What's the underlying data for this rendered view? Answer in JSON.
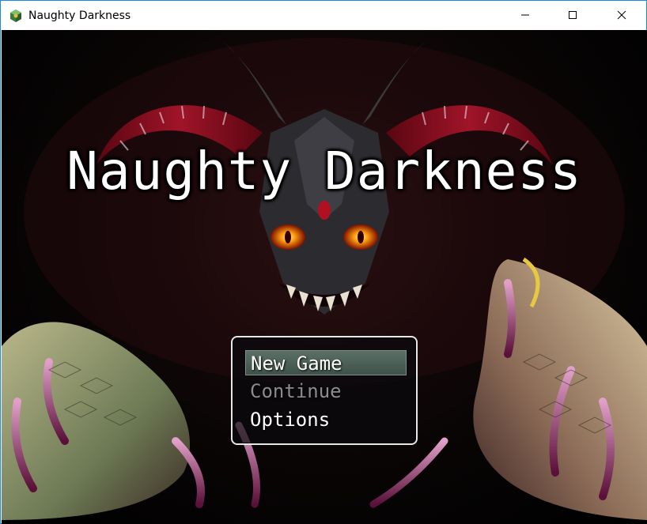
{
  "window": {
    "title": "Naughty Darkness",
    "app_icon": "game-app-icon",
    "controls": {
      "minimize": "minimize-icon",
      "maximize": "maximize-icon",
      "close": "close-icon"
    },
    "accent_color": "#1c8ad6"
  },
  "game": {
    "title": "Naughty Darkness",
    "background": "demon-artwork",
    "menu": {
      "items": [
        {
          "label": "New Game",
          "state": "selected"
        },
        {
          "label": "Continue",
          "state": "disabled"
        },
        {
          "label": "Options",
          "state": "normal"
        }
      ],
      "selected_color": "#4d6259"
    }
  }
}
